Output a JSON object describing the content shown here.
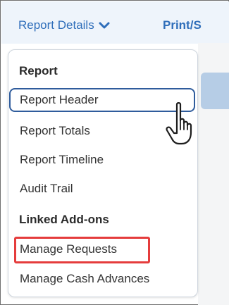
{
  "header": {
    "report_details_label": "Report Details",
    "print_label": "Print/S"
  },
  "menu": {
    "section_report": "Report",
    "items_report": [
      "Report Header",
      "Report Totals",
      "Report Timeline",
      "Audit Trail"
    ],
    "section_addons": "Linked Add-ons",
    "items_addons": [
      "Manage Requests",
      "Manage Cash Advances"
    ]
  },
  "icons": {
    "dropdown": "chevron-down-icon",
    "pointer": "hand-pointer-icon"
  },
  "colors": {
    "link": "#2f6eba",
    "highlight_border": "#2f5c9c",
    "annotation_red": "#e53c3c"
  }
}
